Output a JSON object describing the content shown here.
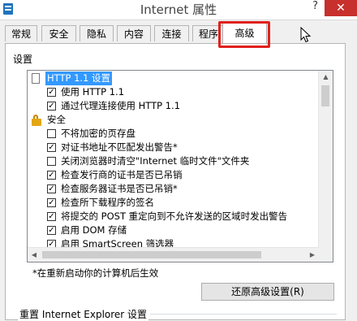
{
  "window": {
    "title": "Internet 属性",
    "help_label": "?",
    "close_label": "✕"
  },
  "tabs": [
    {
      "label": "常规"
    },
    {
      "label": "安全"
    },
    {
      "label": "隐私"
    },
    {
      "label": "内容"
    },
    {
      "label": "连接"
    },
    {
      "label": "程序"
    },
    {
      "label": "高级",
      "selected": true
    }
  ],
  "highlight_color": "#e0211c",
  "settings": {
    "section_label": "设置",
    "items": [
      {
        "type": "group",
        "icon": "document-icon",
        "label": "HTTP 1.1 设置",
        "selected": true
      },
      {
        "type": "check",
        "checked": true,
        "label": "使用 HTTP 1.1"
      },
      {
        "type": "check",
        "checked": true,
        "label": "通过代理连接使用 HTTP 1.1"
      },
      {
        "type": "group",
        "icon": "lock-icon",
        "label": "安全"
      },
      {
        "type": "check",
        "checked": false,
        "label": "不将加密的页存盘"
      },
      {
        "type": "check",
        "checked": true,
        "label": "对证书地址不匹配发出警告*"
      },
      {
        "type": "check",
        "checked": false,
        "label": "关闭浏览器时清空\"Internet 临时文件\"文件夹"
      },
      {
        "type": "check",
        "checked": true,
        "label": "检查发行商的证书是否已吊销"
      },
      {
        "type": "check",
        "checked": true,
        "label": "检查服务器证书是否已吊销*"
      },
      {
        "type": "check",
        "checked": true,
        "label": "检查所下载程序的签名"
      },
      {
        "type": "check",
        "checked": true,
        "label": "将提交的 POST 重定向到不允许发送的区域时发出警告"
      },
      {
        "type": "check",
        "checked": true,
        "label": "启用 DOM 存储"
      },
      {
        "type": "check",
        "checked": true,
        "label": "启用 SmartScreen 筛选器"
      }
    ],
    "restart_note": "*在重新启动你的计算机后生效",
    "restore_button": "还原高级设置(R)"
  },
  "reset_section": {
    "label": "重置 Internet Explorer 设置"
  }
}
